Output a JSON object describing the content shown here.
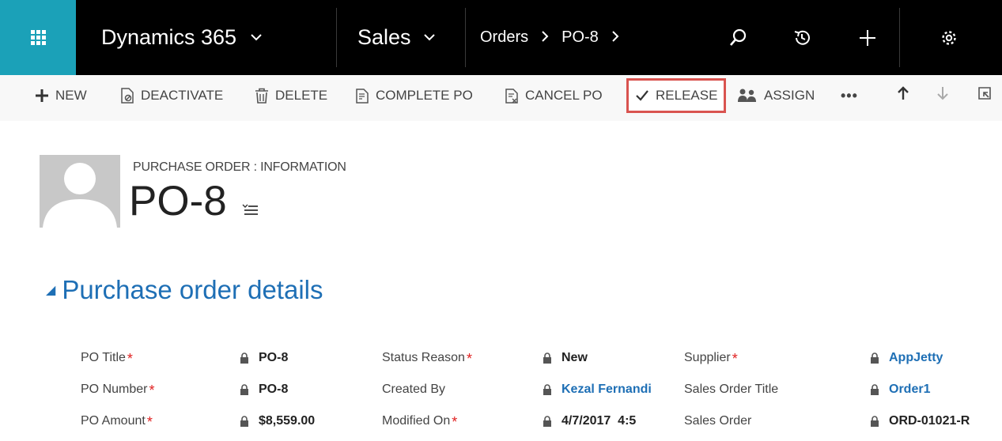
{
  "topnav": {
    "app_title": "Dynamics 365",
    "module": "Sales",
    "breadcrumb": [
      "Orders",
      "PO-8"
    ],
    "colors": {
      "waffle_bg": "#1ba1b8",
      "bar_bg": "#000000"
    }
  },
  "commands": {
    "new": "NEW",
    "deactivate": "DEACTIVATE",
    "delete": "DELETE",
    "complete_po": "COMPLETE PO",
    "cancel_po": "CANCEL PO",
    "release": "RELEASE",
    "assign": "ASSIGN",
    "more": "•••"
  },
  "header": {
    "entity_label": "PURCHASE ORDER : INFORMATION",
    "record_title": "PO-8"
  },
  "section": {
    "title": "Purchase order details"
  },
  "fields": {
    "po_title": {
      "label": "PO Title",
      "value": "PO-8"
    },
    "po_number": {
      "label": "PO Number",
      "value": "PO-8"
    },
    "po_amount": {
      "label": "PO Amount",
      "value": "$8,559.00"
    },
    "status_reason": {
      "label": "Status Reason",
      "value": "New"
    },
    "created_by": {
      "label": "Created By",
      "value": "Kezal Fernandi"
    },
    "modified_on": {
      "label": "Modified On",
      "value": "4/7/2017  4:5"
    },
    "supplier": {
      "label": "Supplier",
      "value": "AppJetty"
    },
    "sales_order_title": {
      "label": "Sales Order Title",
      "value": "Order1"
    },
    "sales_order": {
      "label": "Sales Order",
      "value": "ORD-01021-R"
    }
  },
  "required_marker": "*",
  "highlight_color": "#d9534f"
}
